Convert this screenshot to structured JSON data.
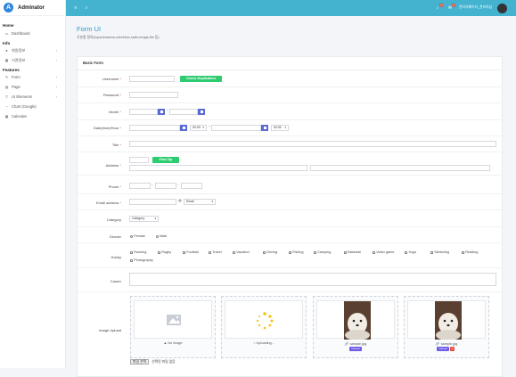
{
  "app": {
    "name": "Adminator",
    "logo_letter": "A"
  },
  "sidebar": {
    "sections": [
      {
        "title": "Home",
        "items": [
          {
            "label": "Dashboard",
            "icon": "monitor-icon"
          }
        ]
      },
      {
        "title": "Info",
        "items": [
          {
            "label": "회원정보",
            "icon": "user-icon"
          },
          {
            "label": "기관정보",
            "icon": "building-icon"
          }
        ]
      },
      {
        "title": "Features",
        "items": [
          {
            "label": "Form",
            "icon": "edit-icon"
          },
          {
            "label": "Page",
            "icon": "file-icon"
          },
          {
            "label": "UI Elements",
            "icon": "filter-icon"
          },
          {
            "label": "Chart (Google)",
            "icon": "chart-icon"
          },
          {
            "label": "Calendar",
            "icon": "calendar-icon"
          }
        ]
      }
    ]
  },
  "topbar": {
    "user_label": "관리자페이지_관리자님",
    "notif_count": "3",
    "mail_count": "2",
    "accent": "#43b3cf"
  },
  "page": {
    "title": "Form UI",
    "subtitle": "기본폼 정의(input,textarea,checkbox,radio,image,file 등)"
  },
  "form": {
    "card_title": "Basic Form",
    "username_label": "Username",
    "check_dup_label": "Check Duplication",
    "password_label": "Password",
    "month_label": "Month",
    "datetime_label": "Date(time)/Hour",
    "time_value_1": "00:00",
    "time_value_2": "00:00",
    "title_label": "Title",
    "address_label": "Address",
    "find_zip_label": "Find Zip",
    "phone_label": "Phone",
    "email_label": "Email address",
    "email_at": "@",
    "email_domain": "Email",
    "category_label": "Category",
    "category_value": "Category",
    "gender_label": "Gender",
    "genders": [
      "Female",
      "Male"
    ],
    "hobby_label": "Hobby",
    "hobbies": [
      "Running",
      "Rugby",
      "Football",
      "Travel",
      "Vacation",
      "Driving",
      "Fishing",
      "Camping",
      "Baseball",
      "Video game",
      "Yoga",
      "Sketching",
      "Reading",
      "Photography"
    ],
    "career_label": "Career",
    "image_label": "Image Upload",
    "uploads": [
      {
        "caption": "No image"
      },
      {
        "caption": "Uploading..."
      },
      {
        "caption": "sample.jpg",
        "tag": "Cancel"
      },
      {
        "caption": "sample.jpg",
        "tag": "Cancel"
      }
    ],
    "file_button": "파일 선택",
    "file_status": "선택된 파일 없음"
  }
}
